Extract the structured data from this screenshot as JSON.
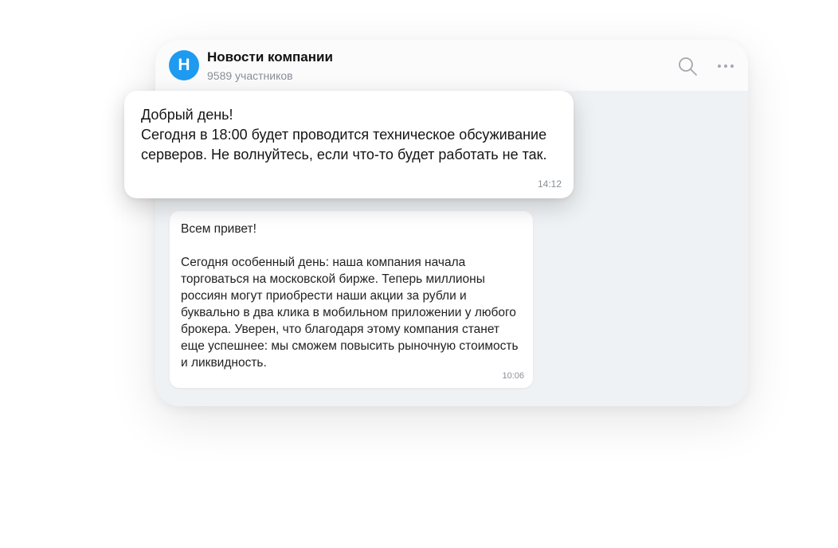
{
  "chat": {
    "avatar_letter": "Н",
    "title": "Новости компании",
    "members": "9589 участников"
  },
  "icons": {
    "search": "search-icon",
    "more": "more-dots-icon"
  },
  "colors": {
    "accent": "#1e9bf0",
    "chat_background": "#eff2f5",
    "bubble": "#ffffff",
    "muted_text": "#8a8f96"
  },
  "messages": [
    {
      "text": "Добрый день!\nСегодня в 18:00 будет проводится техническое обсуживание серверов. Не волнуйтесь, если что-то будет работать не так.",
      "time": "14:12"
    },
    {
      "text": "Всем привет!\n\nСегодня особенный день: наша компания начала торговаться на московской бирже. Теперь миллионы россиян могут приобрести наши акции за рубли и буквально в два клика в мобильном приложении у любого брокера. Уверен, что благодаря этому компания станет еще успешнее: мы сможем повысить рыночную стоимость и ликвидность.",
      "time": "10:06"
    }
  ]
}
